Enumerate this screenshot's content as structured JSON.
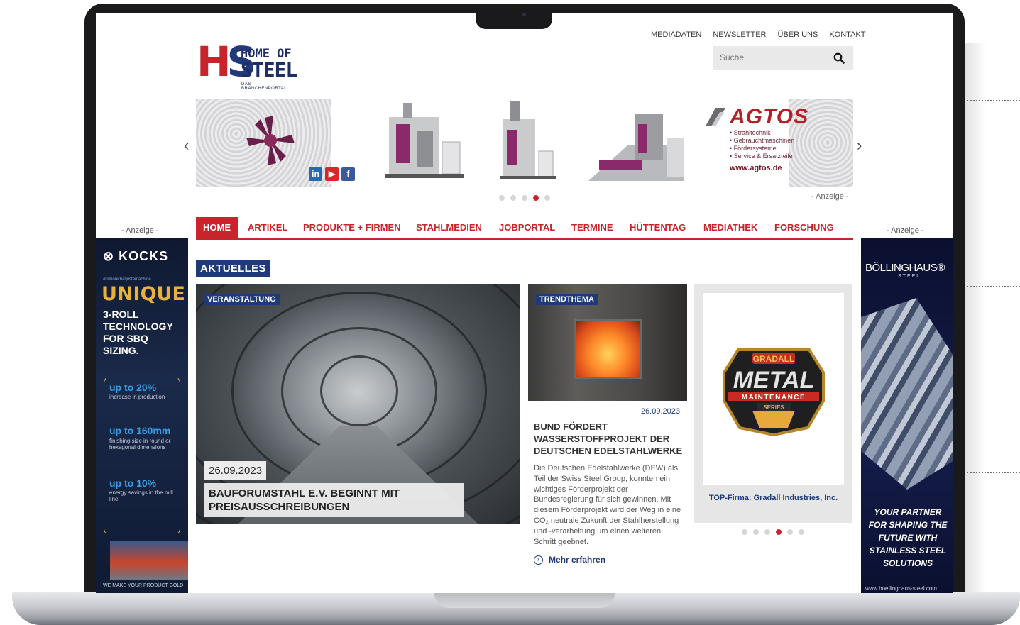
{
  "header": {
    "logo_mark": "HS",
    "logo_line1": "HOME OF",
    "logo_line2": "STEEL",
    "logo_tagline": "DAS BRANCHENPORTAL",
    "top_links": [
      "MEDIADATEN",
      "NEWSLETTER",
      "ÜBER UNS",
      "KONTAKT"
    ],
    "search_placeholder": "Suche",
    "search_icon": "magnifier-icon"
  },
  "banner": {
    "brand": "AGTOS",
    "services": [
      "• Strahltechnik",
      "• Gebrauchtmaschinen",
      "• Fördersysteme",
      "• Service & Ersatzteile"
    ],
    "url": "www.agtos.de",
    "ad_label": "- Anzeige -",
    "social": [
      "in",
      "▶",
      "f"
    ],
    "prev": "‹",
    "next": "›",
    "dots_active": 3
  },
  "nav": {
    "items": [
      "HOME",
      "ARTIKEL",
      "PRODUKTE + FIRMEN",
      "STAHLMEDIEN",
      "JOBPORTAL",
      "TERMINE",
      "HÜTTENTAG",
      "MEDIATHEK",
      "FORSCHUNG"
    ],
    "active": "HOME"
  },
  "side_ads": {
    "left_label": "- Anzeige -",
    "right_label": "- Anzeige -",
    "left": {
      "brand": "⊗ KOCKS",
      "hashtag": "#rsmoretharjustamachine",
      "headline": "UNIQUE",
      "tech": "3-ROLL TECHNOLOGY FOR SBQ SIZING.",
      "stats": [
        {
          "value": "up to 20%",
          "desc": "increase in production"
        },
        {
          "value": "up to 160mm",
          "desc": "finishing size in round or hexagonal dimensions"
        },
        {
          "value": "up to 10%",
          "desc": "energy savings in the mill line"
        }
      ],
      "footer": "WE MAKE YOUR PRODUCT GOLD"
    },
    "right": {
      "brand": "BÖLLINGHAUS®",
      "brand_sub": "STEEL",
      "slogan": "YOUR PARTNER FOR SHAPING THE FUTURE WITH STAINLESS STEEL SOLUTIONS",
      "url": "www.boellinghaus-steel.com"
    }
  },
  "content": {
    "section_title": "AKTUELLES",
    "main": {
      "tag": "VERANSTALTUNG",
      "date": "26.09.2023",
      "title": "BAUFORUMSTAHL E.V. BEGINNT MIT PREISAUSSCHREIBUNGEN"
    },
    "mid": {
      "tag": "TRENDTHEMA",
      "date": "26.09.2023",
      "title": "BUND FÖRDERT WASSERSTOFFPROJEKT DER DEUTSCHEN EDELSTAHLWERKE",
      "text": "Die Deutschen Edelstahlwerke (DEW) als Teil der Swiss Steel Group, konnten ein wichtiges Förderprojekt der Bundesregierung für sich gewinnen. Mit diesem Förderprojekt wird der Weg in eine CO₂ neutrale Zukunft der Stahlherstellung und -verarbeitung um einen weiteren Schritt geebnet.",
      "more": "Mehr erfahren"
    },
    "right": {
      "logo_top": "GRADALL",
      "logo_main": "METAL",
      "logo_band": "MAINTENANCE",
      "logo_series": "SERIES",
      "caption": "TOP-Firma: Gradall Industries, Inc.",
      "dots_active": 3
    }
  }
}
